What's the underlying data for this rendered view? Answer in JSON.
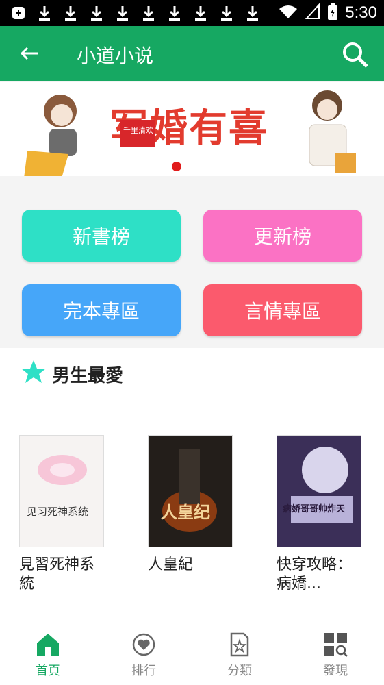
{
  "status_bar": {
    "time": "5:30"
  },
  "app_bar": {
    "title": "小道小说"
  },
  "banner": {
    "title": "军婚有喜",
    "badge": "千里清欢"
  },
  "tiles": [
    {
      "label": "新書榜",
      "color": "#2ee0c6"
    },
    {
      "label": "更新榜",
      "color": "#fb72c4"
    },
    {
      "label": "完本專區",
      "color": "#46a6f9"
    },
    {
      "label": "言情專區",
      "color": "#fb5a6d"
    }
  ],
  "section": {
    "title": "男生最愛",
    "books": [
      {
        "name": "見習死神系統",
        "cover_text": "见习死神系统"
      },
      {
        "name": "人皇紀",
        "cover_text": "人皇纪"
      },
      {
        "name": "快穿攻略：病嬌...",
        "cover_text": "病娇哥哥帅炸天"
      }
    ]
  },
  "bottom_nav": [
    {
      "label": "首頁",
      "icon": "home-icon",
      "active": true
    },
    {
      "label": "排行",
      "icon": "heart-icon",
      "active": false
    },
    {
      "label": "分類",
      "icon": "category-icon",
      "active": false
    },
    {
      "label": "發現",
      "icon": "discover-icon",
      "active": false
    }
  ],
  "colors": {
    "primary": "#16a862",
    "accent_star": "#2ee0c6"
  }
}
